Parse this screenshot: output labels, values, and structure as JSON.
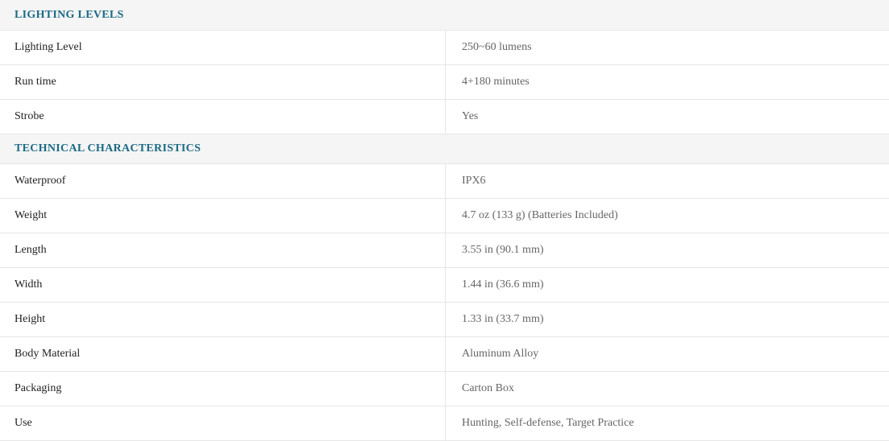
{
  "sections": [
    {
      "title": "LIGHTING LEVELS",
      "rows": [
        {
          "label": "Lighting Level",
          "value": "250~60 lumens"
        },
        {
          "label": "Run time",
          "value": "4+180 minutes"
        },
        {
          "label": "Strobe",
          "value": "Yes"
        }
      ]
    },
    {
      "title": "TECHNICAL CHARACTERISTICS",
      "rows": [
        {
          "label": "Waterproof",
          "value": "IPX6"
        },
        {
          "label": "Weight",
          "value": "4.7 oz (133 g) (Batteries Included)"
        },
        {
          "label": "Length",
          "value": "3.55 in (90.1 mm)"
        },
        {
          "label": "Width",
          "value": "1.44 in (36.6 mm)"
        },
        {
          "label": "Height",
          "value": "1.33 in (33.7 mm)"
        },
        {
          "label": "Body Material",
          "value": "Aluminum Alloy"
        },
        {
          "label": "Packaging",
          "value": "Carton Box"
        },
        {
          "label": "Use",
          "value": "Hunting, Self-defense, Target Practice"
        }
      ]
    }
  ],
  "colors": {
    "section_title": "#1b6a84",
    "section_background": "#f5f5f5",
    "label_text": "#222222",
    "value_text": "#666666",
    "divider": "#e6e6e6"
  }
}
